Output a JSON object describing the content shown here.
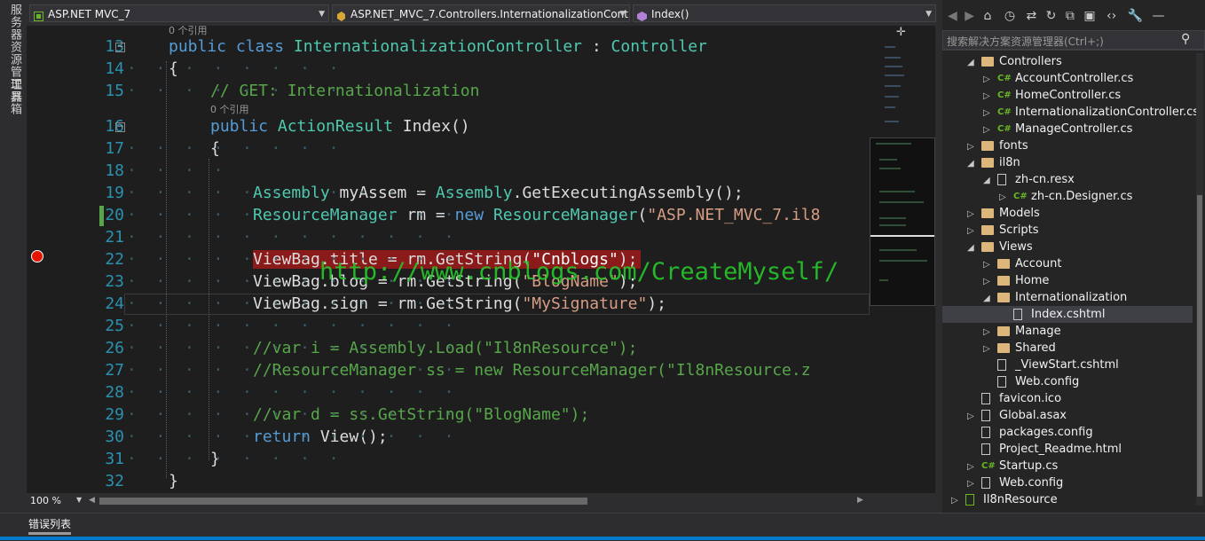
{
  "left_tabs": [
    "服务器资源管理器",
    "工具箱"
  ],
  "nav": {
    "project": "ASP.NET MVC_7",
    "class": "ASP.NET_MVC_7.Controllers.InternationalizationCont",
    "member": "Index()"
  },
  "code_lens": [
    "0 个引用",
    "0 个引用"
  ],
  "lines": [
    "13",
    "14",
    "15",
    "16",
    "17",
    "18",
    "19",
    "20",
    "21",
    "22",
    "23",
    "24",
    "25",
    "26",
    "27",
    "28",
    "29",
    "30",
    "31",
    "32"
  ],
  "code": {
    "l13": [
      "public",
      " class ",
      "InternationalizationController",
      " : ",
      "Controller"
    ],
    "l14": "{",
    "l15": "// GET: Internationalization",
    "l16": [
      "public",
      " ",
      "ActionResult",
      " Index()"
    ],
    "l17": "{",
    "l19": [
      "Assembly",
      " myAssem = ",
      "Assembly",
      ".GetExecutingAssembly();"
    ],
    "l20": [
      "ResourceManager",
      " rm = ",
      "new",
      " ",
      "ResourceManager",
      "(",
      "\"ASP.NET_MVC_7.il8"
    ],
    "l22": [
      "ViewBag.title = rm.GetString(",
      "\"Cnblogs\"",
      ");"
    ],
    "l23": [
      "ViewBag.blog = rm.GetString(",
      "\"BlogName\"",
      ");"
    ],
    "l24": [
      "ViewBag.sign = rm.GetString(",
      "\"MySignature\"",
      ");"
    ],
    "l26": "//var i = Assembly.Load(\"Il8nResource\");",
    "l27": "//ResourceManager ss = new ResourceManager(\"Il8nResource.z",
    "l29": "//var d = ss.GetString(\"BlogName\");",
    "l30": [
      "return",
      " View();"
    ],
    "l31": "}",
    "l32": "}"
  },
  "watermark": "http://www.cnblogs.com/CreateMyself/",
  "zoom": "100 %",
  "search_placeholder": "搜索解决方案资源管理器(Ctrl+;)",
  "tree": [
    {
      "label": "Controllers",
      "kind": "folder-open"
    },
    {
      "label": "AccountController.cs",
      "kind": "cs"
    },
    {
      "label": "HomeController.cs",
      "kind": "cs"
    },
    {
      "label": "InternationalizationController.cs",
      "kind": "cs"
    },
    {
      "label": "ManageController.cs",
      "kind": "cs"
    },
    {
      "label": "fonts",
      "kind": "folder"
    },
    {
      "label": "il8n",
      "kind": "folder-open"
    },
    {
      "label": "zh-cn.resx",
      "kind": "resx"
    },
    {
      "label": "zh-cn.Designer.cs",
      "kind": "cs"
    },
    {
      "label": "Models",
      "kind": "folder"
    },
    {
      "label": "Scripts",
      "kind": "folder"
    },
    {
      "label": "Views",
      "kind": "folder-open"
    },
    {
      "label": "Account",
      "kind": "folder"
    },
    {
      "label": "Home",
      "kind": "folder"
    },
    {
      "label": "Internationalization",
      "kind": "folder-open"
    },
    {
      "label": "Index.cshtml",
      "kind": "cshtml"
    },
    {
      "label": "Manage",
      "kind": "folder"
    },
    {
      "label": "Shared",
      "kind": "folder"
    },
    {
      "label": "_ViewStart.cshtml",
      "kind": "cshtml"
    },
    {
      "label": "Web.config",
      "kind": "config"
    },
    {
      "label": "favicon.ico",
      "kind": "file"
    },
    {
      "label": "Global.asax",
      "kind": "file"
    },
    {
      "label": "packages.config",
      "kind": "config"
    },
    {
      "label": "Project_Readme.html",
      "kind": "file"
    },
    {
      "label": "Startup.cs",
      "kind": "cs"
    },
    {
      "label": "Web.config",
      "kind": "config"
    },
    {
      "label": "Il8nResource",
      "kind": "project"
    }
  ],
  "status_tab": "错误列表",
  "colors": {
    "keyword": "#569cd6",
    "type": "#4ec9b0",
    "comment": "#57a64a",
    "string": "#d69d85",
    "linenum": "#2b91af",
    "breakpoint": "#e51400",
    "watermark": "#26c42a"
  }
}
